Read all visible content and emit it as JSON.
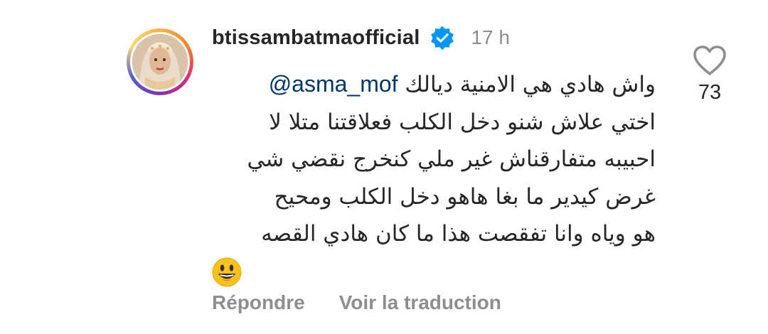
{
  "comment": {
    "author": "btissambatmaofficial",
    "verified": true,
    "time": "17 h",
    "mention": "@asma_mof",
    "lines": [
      "واش هادي هي الامنية ديالك",
      "اختي علاش شنو دخل الكلب فعلاقتنا متلا لا",
      "احبيبه متفارقناش غير ملي كنخرج نقضي شي",
      "غرض كيدير ما بغا هاهو دخل الكلب ومحيح",
      "هو وياه وانا تفقصت هذا ما كان هادي القصه"
    ],
    "emoji": "grinning-face",
    "likes": "73",
    "actions": {
      "reply": "Répondre",
      "translate": "Voir la traduction"
    }
  },
  "colors": {
    "text": "#262626",
    "muted": "#8e8e8e",
    "mention": "#00376b",
    "verified": "#0095f6"
  }
}
